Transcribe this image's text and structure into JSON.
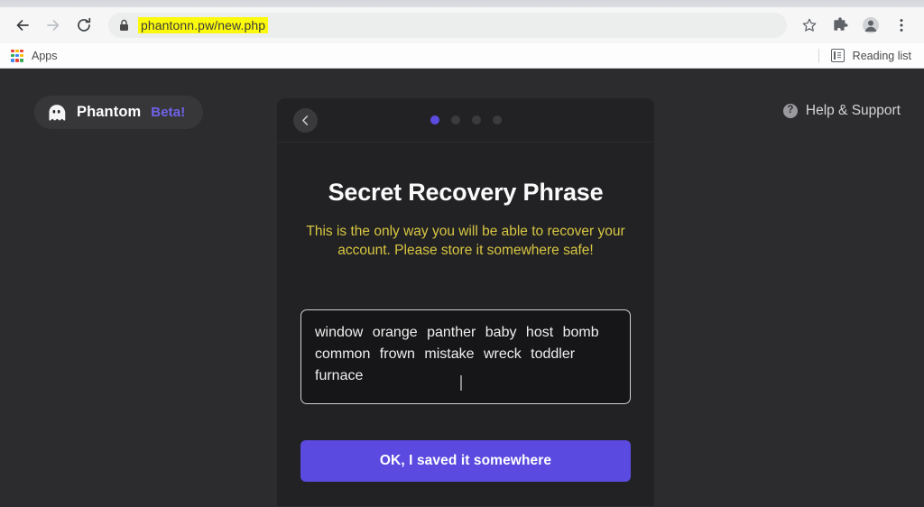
{
  "browser": {
    "nav": {
      "back_icon": "arrow-left-icon",
      "forward_icon": "arrow-right-icon",
      "reload_icon": "reload-icon"
    },
    "omnibox": {
      "lock_icon": "lock-icon",
      "url": "phantonn.pw/new.php",
      "highlight_color": "#fbf90c"
    },
    "toolbar_icons": {
      "bookmark_star": "star-icon",
      "extensions": "puzzle-icon",
      "profile": "avatar-icon",
      "menu": "three-dot-menu-icon"
    },
    "bookmarks_bar": {
      "apps_label": "Apps",
      "apps_icon": "apps-grid-icon",
      "reading_list_label": "Reading list",
      "reading_list_icon": "reading-list-icon"
    }
  },
  "page": {
    "brand": {
      "logo_icon": "phantom-ghost-icon",
      "name": "Phantom",
      "beta_tag": "Beta!",
      "beta_color": "#6f63e8"
    },
    "help": {
      "icon": "question-mark-circle-icon",
      "label": "Help & Support",
      "glyph": "?"
    },
    "card": {
      "back_icon": "chevron-left-icon",
      "steps": {
        "total": 4,
        "current": 1,
        "active_color": "#5b4be0",
        "inactive_color": "#3b3b3d"
      },
      "title": "Secret Recovery Phrase",
      "warning": "This is the only way you will be able to recover your account. Please store it somewhere safe!",
      "warning_color": "#d8c642",
      "seed_phrase": "window orange panther baby host bomb common frown mistake wreck toddler furnace",
      "confirm_label": "OK, I saved it somewhere",
      "confirm_color": "#5a4ae0"
    }
  }
}
